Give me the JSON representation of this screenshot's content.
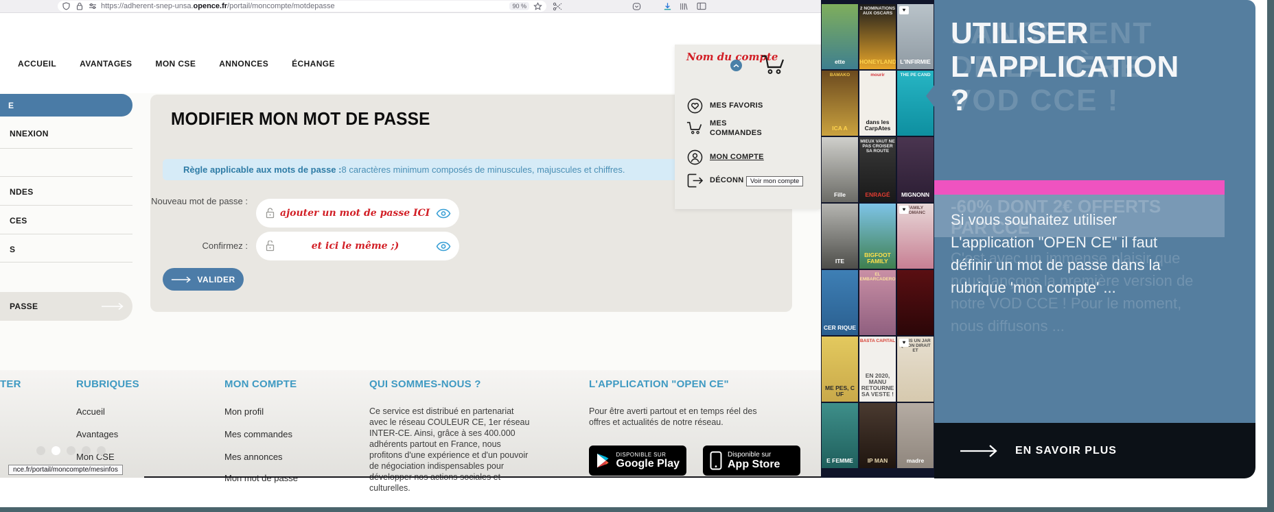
{
  "browser": {
    "url_prefix": "https://adherent-snep-unsa.",
    "url_domain": "opence.fr",
    "url_path": "/portail/moncompte/motdepasse",
    "zoom_level": "90 %"
  },
  "nav": {
    "items": [
      "ACCUEIL",
      "AVANTAGES",
      "MON CSE",
      "ANNONCES",
      "ÉCHANGE"
    ]
  },
  "account_menu": {
    "trigger": "Nom du\ncompte",
    "items": [
      {
        "label": "MES FAVORIS"
      },
      {
        "label": "MES COMMANDES"
      },
      {
        "label": "MON COMPTE"
      },
      {
        "label": "DÉCONN"
      }
    ],
    "tooltip": "Voir mon compte"
  },
  "sidebar": {
    "top_pill": "E",
    "items": [
      "NNEXION",
      "NDES",
      "CES",
      "S"
    ],
    "active_pill": "PASSE"
  },
  "form": {
    "title": "MODIFIER MON MOT DE PASSE",
    "rule_label": "Règle applicable aux mots de passe :",
    "rule_text": " 8 caractères minimum composés de minuscules, majuscules et chiffres.",
    "fields": [
      {
        "label": "Nouveau mot de passe :",
        "value": "ajouter un mot de passe ICI"
      },
      {
        "label": "Confirmez :",
        "value": "et ici le même ;)"
      }
    ],
    "submit_label": "VALIDER"
  },
  "footer": {
    "columns": [
      {
        "heading": "TER"
      },
      {
        "heading": "RUBRIQUES",
        "items": [
          "Accueil",
          "Avantages",
          "Mon CSE"
        ]
      },
      {
        "heading": "MON COMPTE",
        "items": [
          "Mon profil",
          "Mes commandes",
          "Mes annonces",
          "Mon mot de passe"
        ]
      },
      {
        "heading": "QUI SOMMES-NOUS ?",
        "text": "Ce service est distribué en partenariat avec le réseau COULEUR CE, 1er réseau INTER-CE. Ainsi, grâce à ses 400.000 adhérents partout en France, nous profitons d'une expérience et d'un pouvoir de négociation indispensables pour développer nos actions sociales et culturelles."
      },
      {
        "heading": "L'APPLICATION \"OPEN CE\"",
        "text": "Pour être averti partout et en temps réel des offres et actualités de notre réseau."
      }
    ],
    "google_play": {
      "line1": "DISPONIBLE SUR",
      "line2": "Google Play"
    },
    "app_store": {
      "line1": "Disponible sur",
      "line2": "App Store"
    },
    "status_link": "nce.fr/portail/moncompte/mesinfos"
  },
  "promo": {
    "ghost_title": "LANCEMENT\nDE LA 1ÈRE\nVOD CCE !",
    "title": "UTILISER\nL'APPLICATION\n?",
    "ghost_subtitle": "-60% DONT 2€ OFFERTS\nPAR CCE",
    "body": "Si vous souhaitez utiliser\nL'application \"OPEN CE\" il faut\ndéfinir un mot de passe dans la\nrubrique 'mon compte' ...",
    "ghost_body": "C'est avec un immense plaisir que\nnous lançons la première version de\nnotre VOD CCE ! Pour le moment,\nnous diffusons ...",
    "cta": "EN SAVOIR PLUS"
  },
  "posters": [
    {
      "bg": "#7fae5c",
      "bg2": "#3e7f8f",
      "label": "ette",
      "label_color": "#ffffff"
    },
    {
      "bg": "#1c1c1c",
      "bg2": "#e8a62a",
      "top": "2 NOMINATIONS AUX OSCARS",
      "label": "HONEYLAND",
      "label_color": "#ffd34d"
    },
    {
      "bg": "#b9c3c9",
      "bg2": "#8f9aa3",
      "label": "L'INFIRMIE",
      "label_color": "#ffffff",
      "heart": true
    },
    {
      "bg": "#6b4a1f",
      "bg2": "#caa23f",
      "top": "BAMAKO",
      "top_color": "#ffd34d",
      "label": "ICA  A",
      "label_color": "#ffd34d"
    },
    {
      "bg": "#f2efe9",
      "top": "mourir",
      "top_color": "#d21f26",
      "label": "dans les CarpAtes",
      "label_color": "#1a1a1a"
    },
    {
      "bg": "#27b5c4",
      "bg2": "#0e8fa0",
      "top": "THE PE CAND",
      "label": "",
      "label_color": "#ffffff"
    },
    {
      "bg": "#cfcfcb",
      "bg2": "#6b6b66",
      "label": "Fille",
      "label_color": "#ffffff"
    },
    {
      "bg": "#3a3a3a",
      "bg2": "#191919",
      "top": "MIEUX VAUT NE PAS CROISER SA ROUTE",
      "label": "ENRAGÉ",
      "label_color": "#e03c31"
    },
    {
      "bg": "#4a3550",
      "bg2": "#2b1d33",
      "label": "MIGNONN",
      "label_color": "#ffffff"
    },
    {
      "bg": "#b5b5b1",
      "bg2": "#4d4d49",
      "label": "ITE",
      "label_color": "#ffffff"
    },
    {
      "bg": "#7ec4e8",
      "bg2": "#3f7f4f",
      "label": "BIGFOOT FAMILY",
      "label_color": "#ffe04a"
    },
    {
      "bg": "#e8d8d8",
      "bg2": "#c77f93",
      "top": "FAMILY ROMANC",
      "top_color": "#5a3a3a",
      "label": "",
      "heart": true
    },
    {
      "bg": "#3e7fb5",
      "bg2": "#2a5f8f",
      "label": "CER RIQUE",
      "label_color": "#ffffff"
    },
    {
      "bg": "#c98fa5",
      "bg2": "#8f5f7f",
      "top": "EL EMBARCADERO",
      "top_color": "#ffe9a0",
      "label": ""
    },
    {
      "bg": "#5a0f12",
      "bg2": "#2b0608",
      "label": "",
      "label_color": "#ffffff"
    },
    {
      "bg": "#e3c95e",
      "bg2": "#c9a94a",
      "label": "ME  PES,  C  UF",
      "label_color": "#2b2b2b"
    },
    {
      "bg": "#f2f0ec",
      "top": "BASTA CAPITAL",
      "top_color": "#d42b1e",
      "label": "EN 2020, MANU RETOURNE SA VESTE !",
      "label_color": "#555"
    },
    {
      "bg": "#e7dfd0",
      "bg2": "#d6c9ae",
      "top": "DANS UN JAR QU'ON DIRAIT ET",
      "top_color": "#3a3a3a",
      "label": "",
      "heart": true
    },
    {
      "bg": "#3e8f8a",
      "bg2": "#1f5f5c",
      "label": "E FEMME",
      "label_color": "#ffffff"
    },
    {
      "bg": "#4a3a30",
      "bg2": "#1f150f",
      "label": "IP MAN",
      "label_color": "#e8d8b0"
    },
    {
      "bg": "#b5aca3",
      "bg2": "#8f867d",
      "label": "madre",
      "label_color": "#ffffff"
    }
  ]
}
